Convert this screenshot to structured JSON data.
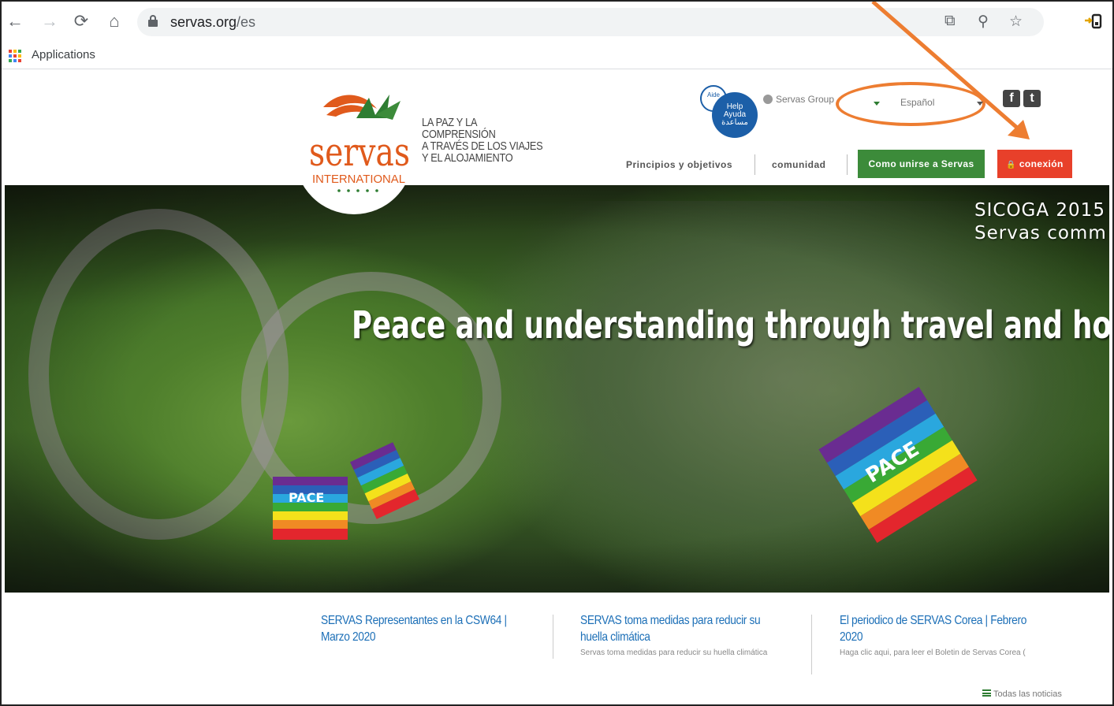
{
  "browser": {
    "url_host": "servas.org",
    "url_path": "/es",
    "bookmarks_label": "Applications",
    "icons": [
      "back-icon",
      "forward-icon",
      "reload-icon",
      "home-icon",
      "lock-icon",
      "translate-icon",
      "zoom-icon",
      "star-icon",
      "extension-icon"
    ]
  },
  "header": {
    "logo_word": "servas",
    "logo_sub": "INTERNATIONAL",
    "tagline": [
      "LA PAZ Y LA",
      "COMPRENSIÓN",
      "A TRAVÉS DE LOS VIAJES",
      "Y EL ALOJAMIENTO"
    ],
    "help_small": "Aide",
    "help_big": [
      "Help",
      "Ayuda",
      "مساعدة"
    ],
    "groups_label": "Servas Group",
    "language_selected": "Español",
    "nav": {
      "principles": "Principios y objetivos",
      "community": "comunidad",
      "join": "Como unirse a Servas",
      "login": "conexión",
      "login_icon": "🔒"
    }
  },
  "hero": {
    "title": "Peace and understanding through travel and hosting",
    "subtitle_line1": "SICOGA 2015",
    "subtitle_line2": "Servas comm",
    "flag_text": "PACE"
  },
  "news": {
    "items": [
      {
        "title": "SERVAS Representantes en la CSW64 | Marzo 2020",
        "desc": ""
      },
      {
        "title": "SERVAS toma medidas para reducir su huella climática",
        "desc": "Servas toma medidas para reducir su huella climática"
      },
      {
        "title": "El periodico de SERVAS Corea | Febrero 2020",
        "desc": "Haga clic aqui, para leer el Boletin de Servas Corea ("
      }
    ],
    "all_label": "Todas las noticias"
  },
  "colors": {
    "accent_orange": "#ed7d31",
    "green_button": "#3c8b3a",
    "red_button": "#e8402a",
    "link_blue": "#1c6fb7",
    "logo_orange": "#e05a1c",
    "logo_green": "#2e7d32"
  }
}
